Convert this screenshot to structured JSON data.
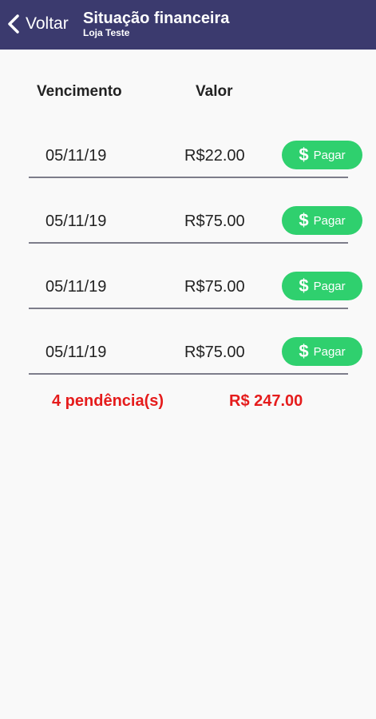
{
  "header": {
    "back_label": "Voltar",
    "title": "Situação financeira",
    "subtitle": "Loja Teste"
  },
  "table": {
    "col_due": "Vencimento",
    "col_value": "Valor",
    "rows": [
      {
        "date": "05/11/19",
        "amount": "R$22.00",
        "pay_label": "Pagar"
      },
      {
        "date": "05/11/19",
        "amount": "R$75.00",
        "pay_label": "Pagar"
      },
      {
        "date": "05/11/19",
        "amount": "R$75.00",
        "pay_label": "Pagar"
      },
      {
        "date": "05/11/19",
        "amount": "R$75.00",
        "pay_label": "Pagar"
      }
    ]
  },
  "summary": {
    "pending": "4 pendência(s)",
    "total": "R$ 247.00"
  },
  "colors": {
    "header_bg": "#3b3a6e",
    "pay_button": "#2fd06e",
    "summary_text": "#e51c1c"
  },
  "icons": {
    "back": "chevron-left-icon",
    "pay": "dollar-icon"
  }
}
